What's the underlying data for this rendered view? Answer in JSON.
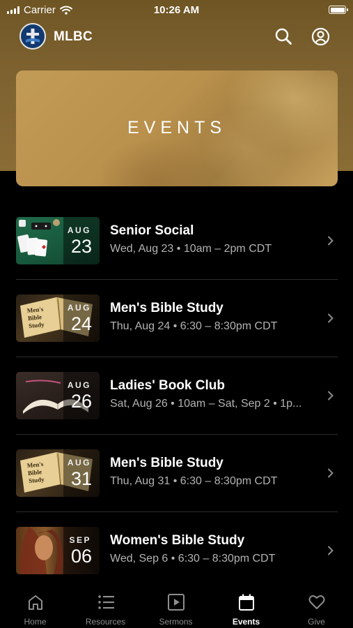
{
  "status_bar": {
    "carrier": "Carrier",
    "time": "10:26 AM"
  },
  "app_bar": {
    "title": "MLBC"
  },
  "hero": {
    "title": "EVENTS"
  },
  "events": [
    {
      "title": "Senior Social",
      "subtitle": "Wed, Aug 23 • 10am – 2pm CDT",
      "month": "AUG",
      "day": "23"
    },
    {
      "title": "Men's Bible Study",
      "subtitle": "Thu, Aug 24 • 6:30 – 8:30pm CDT",
      "month": "AUG",
      "day": "24",
      "thumb_text": [
        "Men's",
        "Bible",
        "Study"
      ]
    },
    {
      "title": "Ladies' Book Club",
      "subtitle": "Sat, Aug 26 • 10am – Sat, Sep 2 • 1p...",
      "month": "AUG",
      "day": "26"
    },
    {
      "title": "Men's Bible Study",
      "subtitle": "Thu, Aug 31 • 6:30 – 8:30pm CDT",
      "month": "AUG",
      "day": "31",
      "thumb_text": [
        "Men's",
        "Bible",
        "Study"
      ]
    },
    {
      "title": "Women's Bible Study",
      "subtitle": "Wed, Sep 6 • 6:30 – 8:30pm CDT",
      "month": "SEP",
      "day": "06"
    }
  ],
  "tabs": [
    {
      "label": "Home",
      "icon": "home-icon"
    },
    {
      "label": "Resources",
      "icon": "list-icon"
    },
    {
      "label": "Sermons",
      "icon": "play-icon"
    },
    {
      "label": "Events",
      "icon": "calendar-icon",
      "active": true
    },
    {
      "label": "Give",
      "icon": "heart-icon"
    }
  ],
  "colors": {
    "header_bg": "#7d6230",
    "accent_text": "#ffffff",
    "muted_text": "#b3b3b3",
    "tab_inactive": "#8e8e8e"
  }
}
